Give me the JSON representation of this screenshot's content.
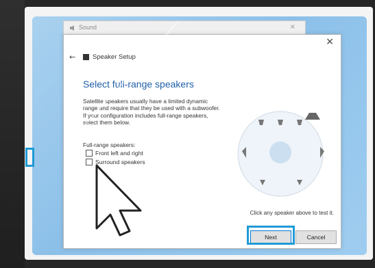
{
  "sound_window": {
    "title": "Sound",
    "close": "×"
  },
  "dialog": {
    "close": "×",
    "back": "←",
    "title": "Speaker Setup",
    "heading": "Select full-range speakers",
    "description": "Satellite speakers usually have a limited dynamic range and require that they be used with a subwoofer. If your configuration includes full-range speakers, select them below.",
    "group_label": "Full-range speakers:",
    "checkboxes": [
      {
        "label": "Front left and right",
        "checked": false
      },
      {
        "label": "Surround speakers",
        "checked": false
      }
    ],
    "hint": "Click any speaker above to test it.",
    "buttons": {
      "next": "Next",
      "cancel": "Cancel"
    }
  },
  "colors": {
    "highlight": "#1f9ad6",
    "heading": "#1f5fa6",
    "desktop": "#9fcdf0"
  }
}
